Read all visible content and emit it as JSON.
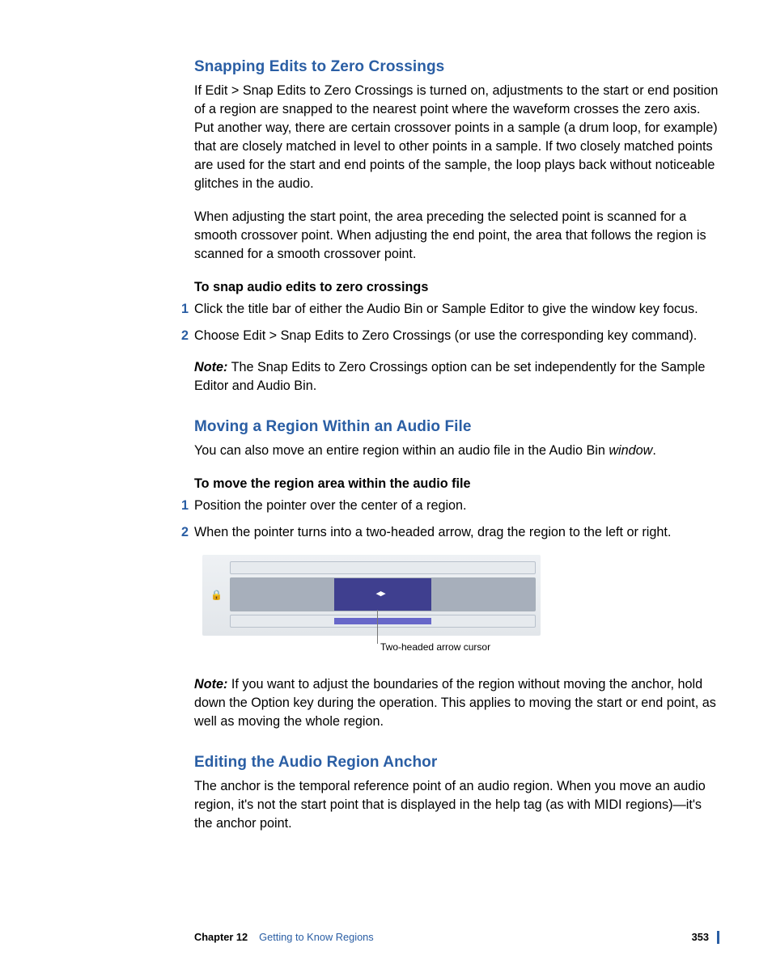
{
  "section1": {
    "heading": "Snapping Edits to Zero Crossings",
    "para1": "If Edit > Snap Edits to Zero Crossings is turned on, adjustments to the start or end position of a region are snapped to the nearest point where the waveform crosses the zero axis. Put another way, there are certain crossover points in a sample (a drum loop, for example) that are closely matched in level to other points in a sample. If two closely matched points are used for the start and end points of the sample, the loop plays back without noticeable glitches in the audio.",
    "para2": "When adjusting the start point, the area preceding the selected point is scanned for a smooth crossover point. When adjusting the end point, the area that follows the region is scanned for a smooth crossover point.",
    "task_heading": "To snap audio edits to zero crossings",
    "step1_num": "1",
    "step1": "Click the title bar of either the Audio Bin or Sample Editor to give the window key focus.",
    "step2_num": "2",
    "step2": "Choose Edit > Snap Edits to Zero Crossings (or use the corresponding key command).",
    "note_label": "Note:",
    "note_text": "The Snap Edits to Zero Crossings option can be set independently for the Sample Editor and Audio Bin."
  },
  "section2": {
    "heading": "Moving a Region Within an Audio File",
    "intro_a": "You can also move an entire region within an audio file in the Audio Bin ",
    "intro_em": "window",
    "intro_b": ".",
    "task_heading": "To move the region area within the audio file",
    "step1_num": "1",
    "step1": "Position the pointer over the center of a region.",
    "step2_num": "2",
    "step2": "When the pointer turns into a two-headed arrow, drag the region to the left or right.",
    "callout": "Two-headed arrow cursor",
    "note_label": "Note:",
    "note_text": "If you want to adjust the boundaries of the region without moving the anchor, hold down the Option key during the operation. This applies to moving the start or end point, as well as moving the whole region."
  },
  "section3": {
    "heading": "Editing the Audio Region Anchor",
    "para": "The anchor is the temporal reference point of an audio region. When you move an audio region, it's not the start point that is displayed in the help tag (as with MIDI regions)—it's the anchor point."
  },
  "footer": {
    "chapter": "Chapter 12",
    "title": "Getting to Know Regions",
    "page": "353"
  }
}
